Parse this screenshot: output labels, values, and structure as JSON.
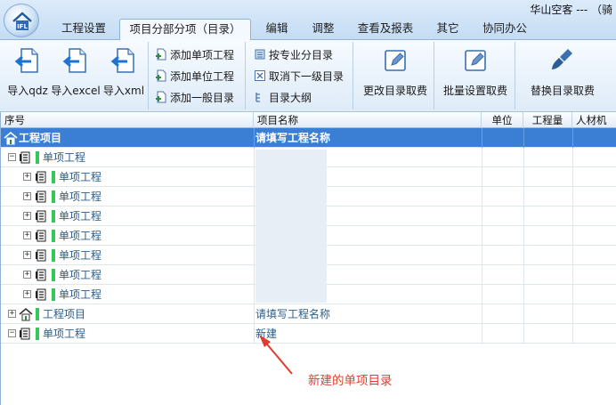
{
  "logo_text": "IFL",
  "user_label": "华山空客 --- （骑",
  "tabs": [
    {
      "label": "工程设置",
      "active": false
    },
    {
      "label": "项目分部分项（目录）",
      "active": true
    },
    {
      "label": "编辑",
      "active": false
    },
    {
      "label": "调整",
      "active": false
    },
    {
      "label": "查看及报表",
      "active": false
    },
    {
      "label": "其它",
      "active": false
    },
    {
      "label": "协同办公",
      "active": false
    }
  ],
  "ribbon": {
    "import_qdz": "导入qdz",
    "import_excel": "导入excel",
    "import_xml": "导入xml",
    "add_single": "添加单项工程",
    "add_unit": "添加单位工程",
    "add_general": "添加一般目录",
    "by_major": "按专业分目录",
    "cancel_next": "取消下一级目录",
    "outline": "目录大纲",
    "change_fee": "更改目录取费",
    "batch_fee": "批量设置取费",
    "replace_fee": "替换目录取费"
  },
  "columns": {
    "seq": "序号",
    "name": "项目名称",
    "unit": "单位",
    "qty": "工程量",
    "labor": "人材机"
  },
  "rows": [
    {
      "label": "工程项目",
      "name": "请填写工程名称"
    },
    {
      "label": "单项工程",
      "name": ""
    },
    {
      "label": "单项工程",
      "name": ""
    },
    {
      "label": "单项工程",
      "name": ""
    },
    {
      "label": "单项工程",
      "name": ""
    },
    {
      "label": "单项工程",
      "name": ""
    },
    {
      "label": "单项工程",
      "name": ""
    },
    {
      "label": "单项工程",
      "name": ""
    },
    {
      "label": "单项工程",
      "name": ""
    },
    {
      "label": "工程项目",
      "name": "请填写工程名称"
    },
    {
      "label": "单项工程",
      "name": "新建"
    }
  ],
  "annotation": "新建的单项目录",
  "colors": {
    "accent": "#3b7fd4",
    "annotation": "#e23b2e",
    "tree_green": "#34c759"
  }
}
